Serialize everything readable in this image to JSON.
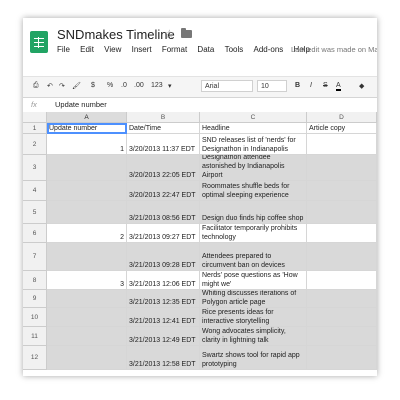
{
  "app": {
    "doc_title": "SNDmakes Timeline",
    "menu": [
      "File",
      "Edit",
      "View",
      "Insert",
      "Format",
      "Data",
      "Tools",
      "Add-ons",
      "Help"
    ],
    "last_edit": "Last edit was made on Ma",
    "brand_color": "#21a464"
  },
  "toolbar": {
    "currency": "$",
    "percent": "%",
    "decimal_less": ".0",
    "decimal_more": ".00",
    "more_formats": "123",
    "font": "Arial",
    "font_size": "10",
    "bold": "B",
    "italic": "I",
    "strike": "S",
    "text_color": "A"
  },
  "formula_bar": {
    "label": "fx",
    "value": "Update number"
  },
  "sheet": {
    "columns": [
      "A",
      "B",
      "C",
      "D"
    ],
    "header_row": {
      "num": "1",
      "cells": [
        "Update number",
        "Date/Time",
        "Headline",
        "Article copy"
      ]
    },
    "rows": [
      {
        "num": "2",
        "shaded": false,
        "a": "1",
        "b": "3/20/2013 11:37 EDT",
        "c": "SND releases list of 'nerds' for Designathon in Indianapolis",
        "d": ""
      },
      {
        "num": "3",
        "shaded": true,
        "a": "",
        "b": "3/20/2013 22:05 EDT",
        "c": "Designathon attendee astonished by Indianapolis Airport",
        "d": ""
      },
      {
        "num": "4",
        "shaded": true,
        "a": "",
        "b": "3/20/2013 22:47 EDT",
        "c": "Roommates shuffle beds for optimal sleeping experience",
        "d": ""
      },
      {
        "num": "5",
        "shaded": true,
        "a": "",
        "b": "3/21/2013 08:56 EDT",
        "c": "Design duo finds hip coffee shop",
        "d": ""
      },
      {
        "num": "6",
        "shaded": false,
        "a": "2",
        "b": "3/21/2013 09:27 EDT",
        "c": "Facilitator temporarily prohibits technology",
        "d": ""
      },
      {
        "num": "7",
        "shaded": true,
        "a": "",
        "b": "3/21/2013 09:28 EDT",
        "c": "Attendees prepared to circumvent ban on devices",
        "d": ""
      },
      {
        "num": "8",
        "shaded": false,
        "a": "3",
        "b": "3/21/2013 12:06 EDT",
        "c": "Nerds' pose questions as 'How might we'",
        "d": ""
      },
      {
        "num": "9",
        "shaded": true,
        "a": "",
        "b": "3/21/2013 12:35 EDT",
        "c": "Whiting discusses iterations of Polygon article page",
        "d": ""
      },
      {
        "num": "10",
        "shaded": true,
        "a": "",
        "b": "3/21/2013 12:41 EDT",
        "c": "Rice presents ideas for interactive storytelling",
        "d": ""
      },
      {
        "num": "11",
        "shaded": true,
        "a": "",
        "b": "3/21/2013 12:49 EDT",
        "c": "Wong advocates simplicity, clarity in lightning talk",
        "d": ""
      },
      {
        "num": "12",
        "shaded": true,
        "a": "",
        "b": "3/21/2013 12:58 EDT",
        "c": "Swartz shows tool for rapid app prototyping",
        "d": ""
      }
    ]
  }
}
